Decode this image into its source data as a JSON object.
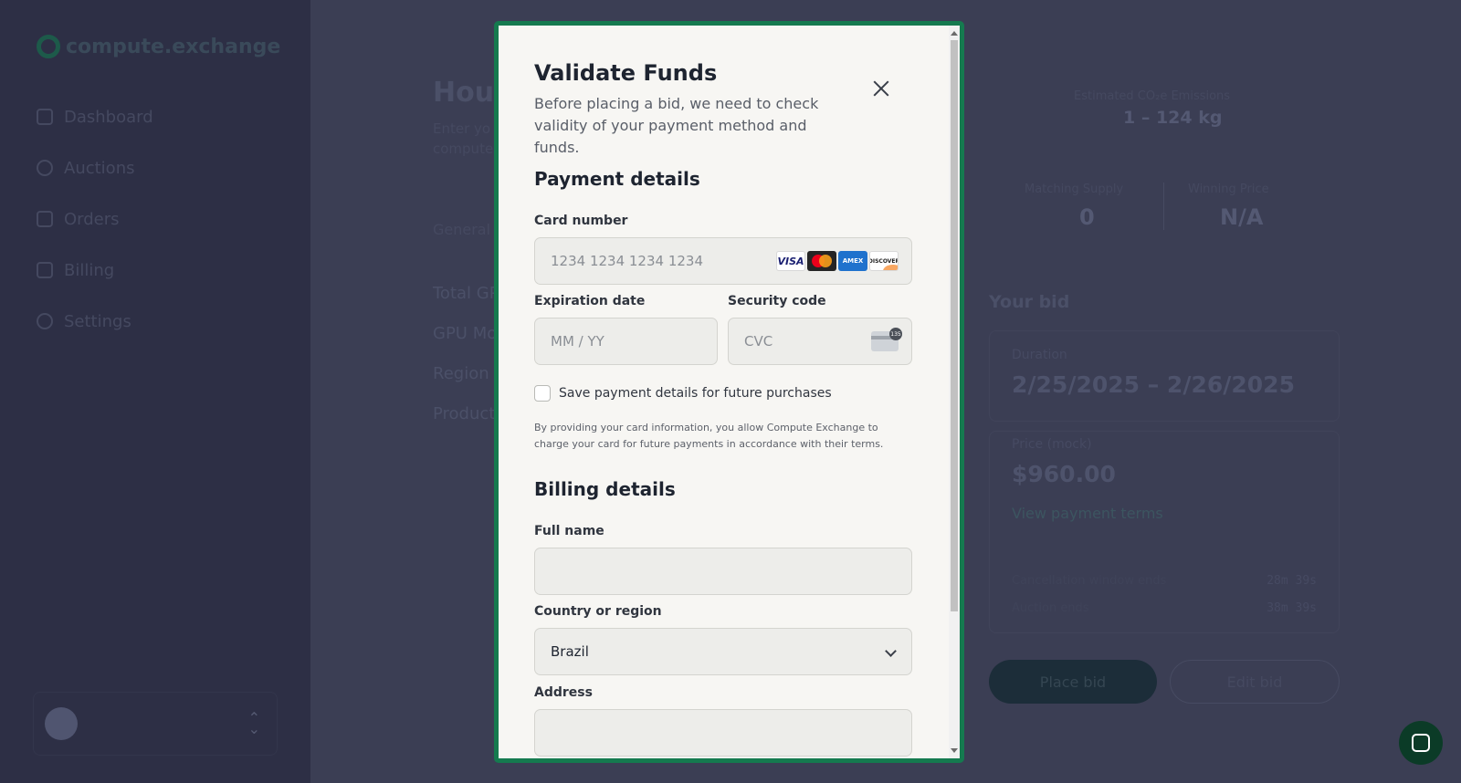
{
  "app": {
    "logo_text": "compute.exchange",
    "nav": [
      {
        "label": "Dashboard",
        "icon": "grid-icon"
      },
      {
        "label": "Auctions",
        "icon": "clock-icon"
      },
      {
        "label": "Orders",
        "icon": "list-icon"
      },
      {
        "label": "Billing",
        "icon": "receipt-icon"
      },
      {
        "label": "Settings",
        "icon": "gear-icon"
      }
    ]
  },
  "background": {
    "page_title": "Hour",
    "page_sub_line1": "Enter yo",
    "page_sub_line2": "compute",
    "tab_general": "General",
    "fields": [
      "Total GP",
      "GPU Mo",
      "Region",
      "Product"
    ],
    "emissions_label": "Estimated CO₂e Emissions",
    "emissions_value": "1 – 124 kg",
    "matching_supply_label": "Matching Supply",
    "matching_supply_value": "0",
    "winning_price_label": "Winning Price",
    "winning_price_value": "N/A",
    "your_bid": "Your bid",
    "duration_label": "Duration",
    "duration_value": "2/25/2025 – 2/26/2025",
    "price_label": "Price (mock)",
    "price_value": "$960.00",
    "payment_terms_link": "View payment terms",
    "cancellation_label": "Cancellation window ends",
    "cancellation_value": "28m 39s",
    "auction_ends_label": "Auction ends",
    "auction_ends_value": "38m 39s",
    "place_bid": "Place bid",
    "edit_bid": "Edit bid"
  },
  "modal": {
    "title": "Validate Funds",
    "description": "Before placing a bid, we need to check validity of your payment method and funds.",
    "payment_section": "Payment details",
    "card_number_label": "Card number",
    "card_number_placeholder": "1234 1234 1234 1234",
    "card_brands": [
      "VISA",
      "Mastercard",
      "AMEX",
      "DISCOVER"
    ],
    "expiration_label": "Expiration date",
    "expiration_placeholder": "MM / YY",
    "security_label": "Security code",
    "security_placeholder": "CVC",
    "cvc_badge": "135",
    "save_checkbox_label": "Save payment details for future purchases",
    "save_checked": false,
    "legal_text": "By providing your card information, you allow Compute Exchange to charge your card for future payments in accordance with their terms.",
    "billing_section": "Billing details",
    "full_name_label": "Full name",
    "full_name_value": "",
    "country_label": "Country or region",
    "country_value": "Brazil",
    "address_label": "Address",
    "address_value": ""
  }
}
